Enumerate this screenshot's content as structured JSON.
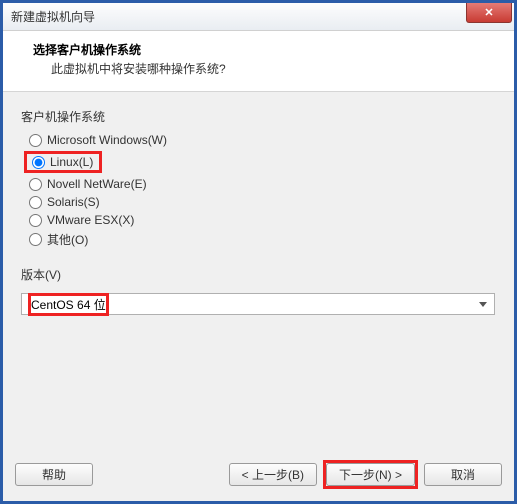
{
  "window": {
    "title": "新建虚拟机向导",
    "close_glyph": "✕"
  },
  "header": {
    "title": "选择客户机操作系统",
    "subtitle": "此虚拟机中将安装哪种操作系统?"
  },
  "os_group": {
    "label": "客户机操作系统",
    "selected": "linux",
    "options": [
      {
        "id": "windows",
        "label": "Microsoft Windows(W)"
      },
      {
        "id": "linux",
        "label": "Linux(L)"
      },
      {
        "id": "netware",
        "label": "Novell NetWare(E)"
      },
      {
        "id": "solaris",
        "label": "Solaris(S)"
      },
      {
        "id": "vmware",
        "label": "VMware ESX(X)"
      },
      {
        "id": "other",
        "label": "其他(O)"
      }
    ]
  },
  "version": {
    "label": "版本(V)",
    "selected": "CentOS 64 位"
  },
  "buttons": {
    "help": "帮助",
    "back": "< 上一步(B)",
    "next": "下一步(N) >",
    "cancel": "取消"
  }
}
